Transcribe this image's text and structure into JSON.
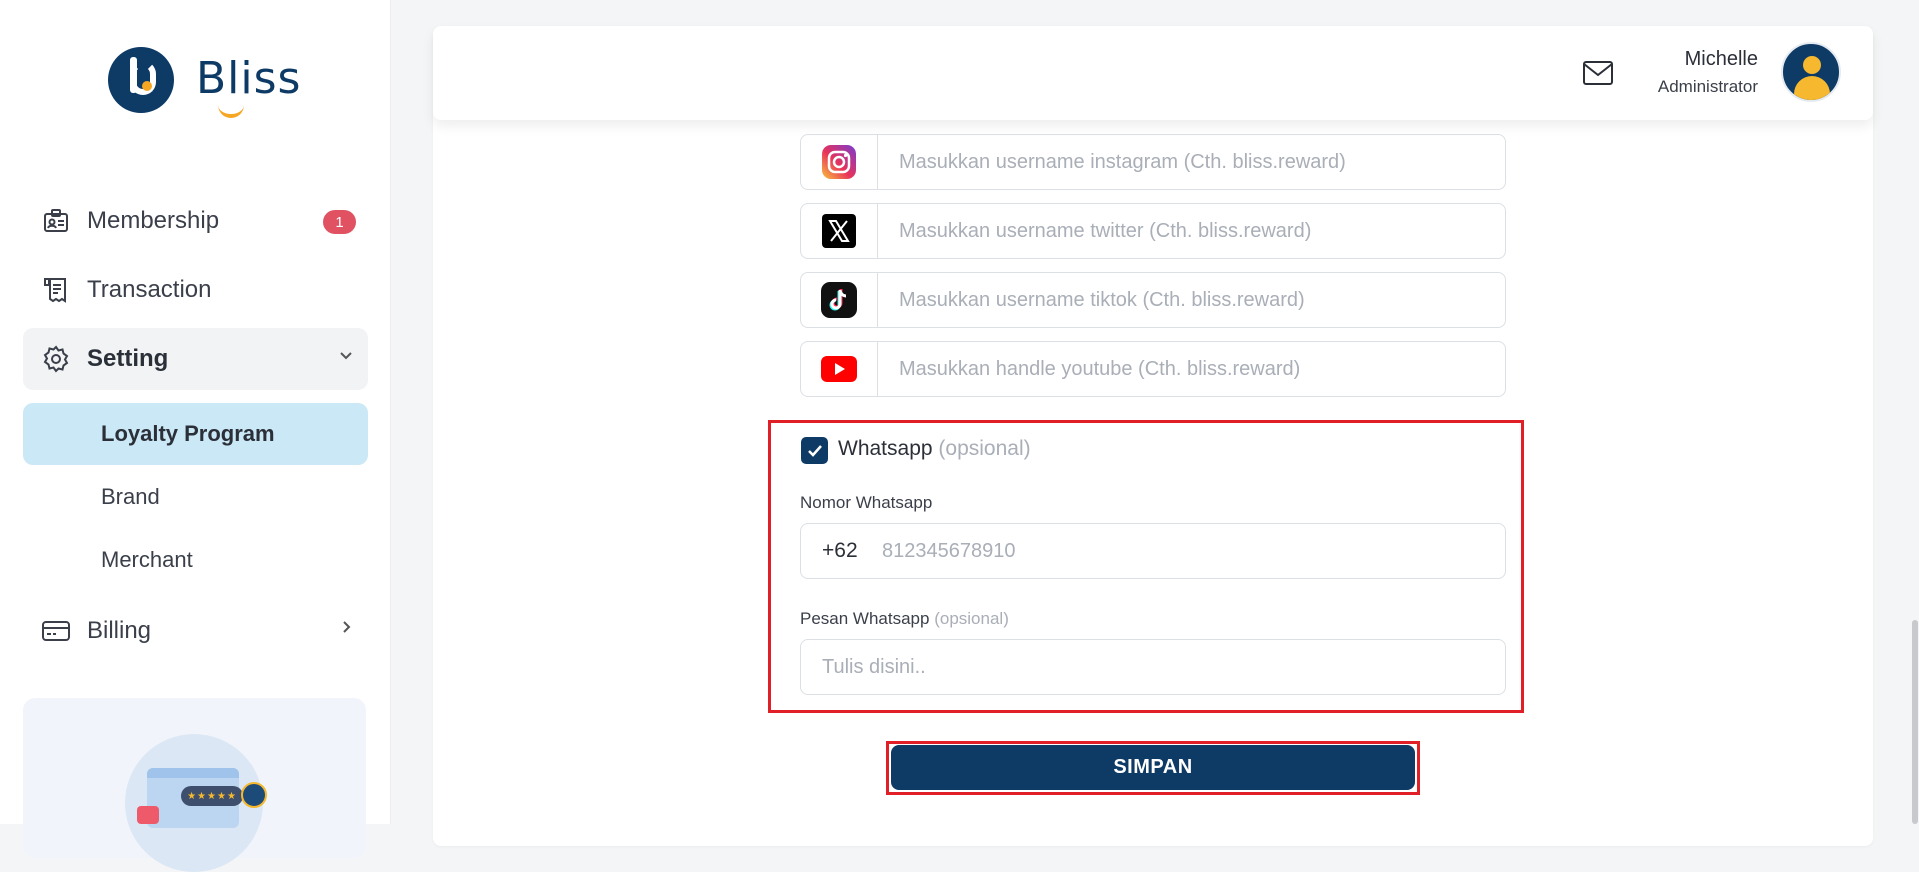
{
  "brand": {
    "name": "Bliss"
  },
  "sidebar": {
    "items": [
      {
        "label": "Membership",
        "icon": "id-card-icon",
        "badge": "1"
      },
      {
        "label": "Transaction",
        "icon": "receipt-icon"
      },
      {
        "label": "Setting",
        "icon": "gear-icon",
        "expanded": true,
        "children": [
          {
            "label": "Loyalty Program",
            "active": true
          },
          {
            "label": "Brand"
          },
          {
            "label": "Merchant"
          }
        ]
      },
      {
        "label": "Billing",
        "icon": "credit-card-icon"
      }
    ]
  },
  "header": {
    "user_name": "Michelle",
    "user_role": "Administrator",
    "mail_icon": "mail-icon",
    "avatar_icon": "user-avatar-icon"
  },
  "social": {
    "instagram_placeholder": "Masukkan username instagram (Cth. bliss.reward)",
    "twitter_placeholder": "Masukkan username twitter (Cth. bliss.reward)",
    "tiktok_placeholder": "Masukkan username tiktok (Cth. bliss.reward)",
    "youtube_placeholder": "Masukkan handle youtube (Cth. bliss.reward)"
  },
  "whatsapp": {
    "checkbox_label": "Whatsapp",
    "checkbox_optional": "(opsional)",
    "checked": true,
    "number_label": "Nomor Whatsapp",
    "country_code": "+62",
    "number_placeholder": "812345678910",
    "message_label": "Pesan Whatsapp",
    "message_optional": "(opsional)",
    "message_placeholder": "Tulis disini.."
  },
  "actions": {
    "save_label": "SIMPAN"
  },
  "colors": {
    "primary": "#0e3a66",
    "highlight_outline": "#e01f26",
    "active_submenu_bg": "#cbe8f7",
    "badge": "#e05262",
    "accent": "#f5a623"
  }
}
